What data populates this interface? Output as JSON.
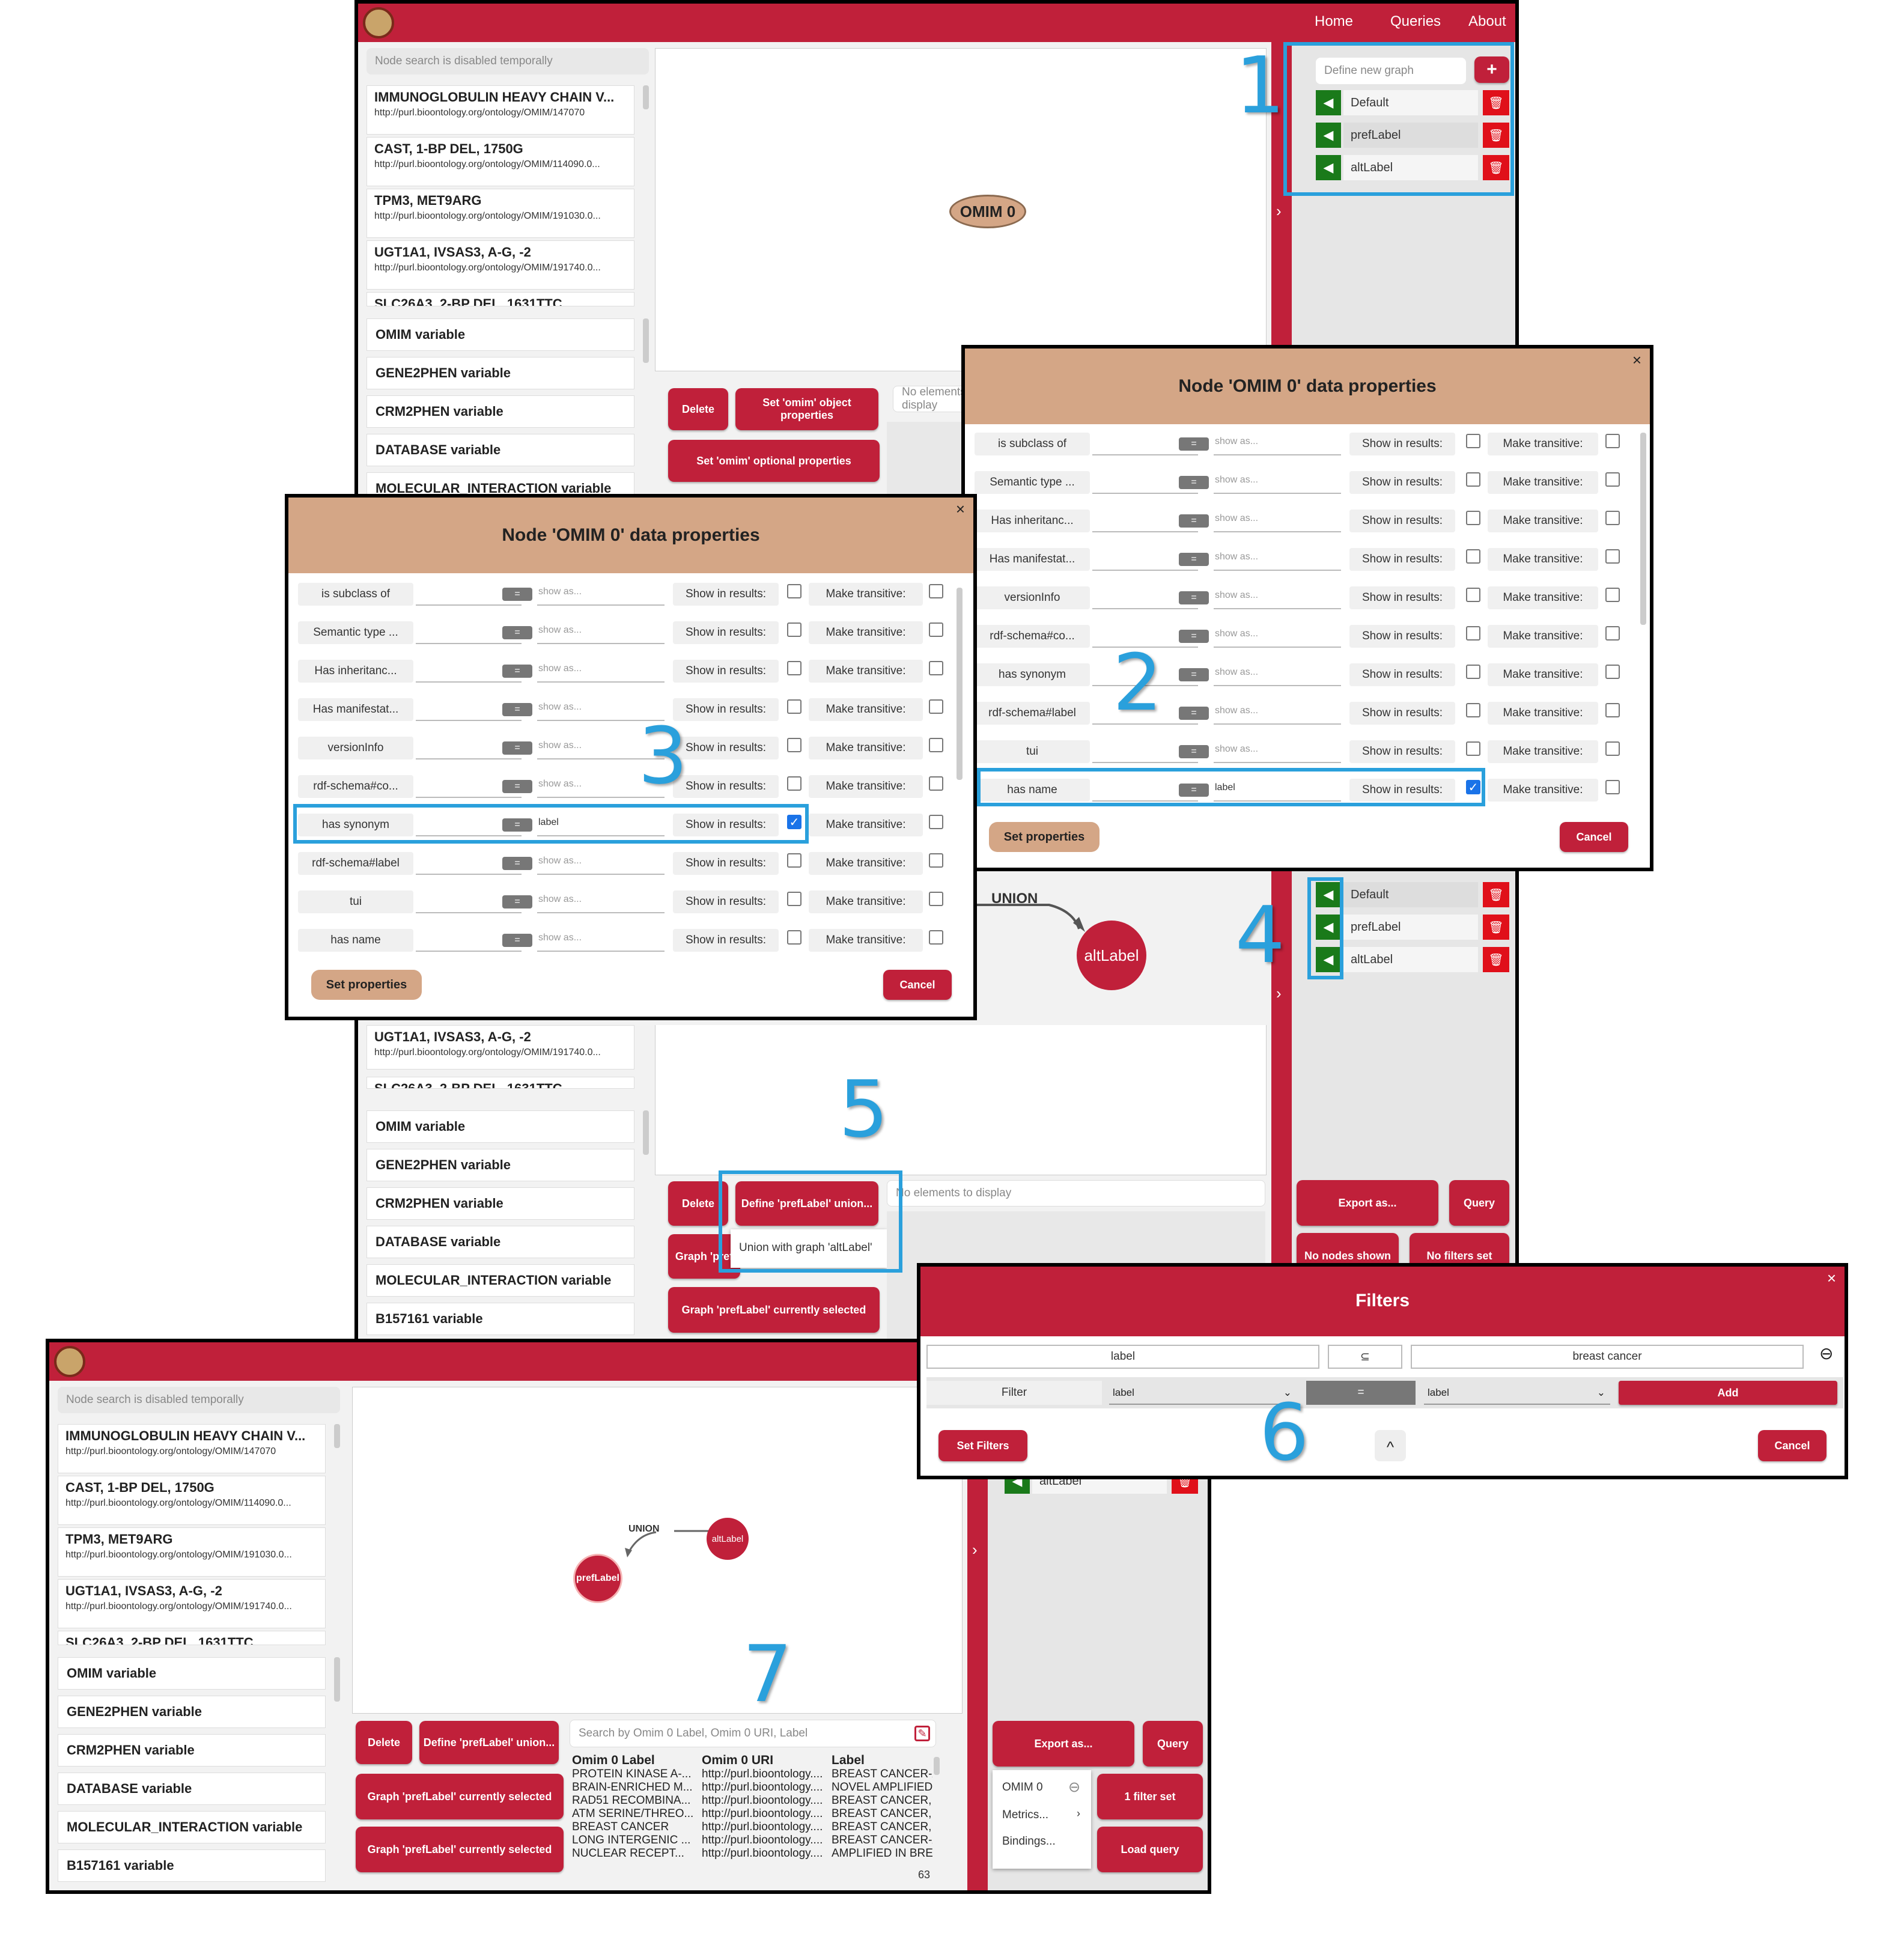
{
  "nav": {
    "home": "Home",
    "queries": "Queries",
    "about": "About"
  },
  "node_search_placeholder": "Node search is disabled temporally",
  "results": [
    {
      "title": "IMMUNOGLOBULIN HEAVY CHAIN V...",
      "url": "http://purl.bioontology.org/ontology/OMIM/147070"
    },
    {
      "title": "CAST, 1-BP DEL, 1750G",
      "url": "http://purl.bioontology.org/ontology/OMIM/114090.0..."
    },
    {
      "title": "TPM3, MET9ARG",
      "url": "http://purl.bioontology.org/ontology/OMIM/191030.0..."
    },
    {
      "title": "UGT1A1, IVSAS3, A-G, -2",
      "url": "http://purl.bioontology.org/ontology/OMIM/191740.0..."
    }
  ],
  "results_cut": "SLC26A3, 2-BP DEL, 1631TTC",
  "variables": [
    "OMIM variable",
    "GENE2PHEN variable",
    "CRM2PHEN variable",
    "DATABASE variable",
    "MOLECULAR_INTERACTION variable",
    "B157161 variable"
  ],
  "graph_panel": {
    "new_graph_placeholder": "Define new graph",
    "add_label": "+",
    "graphs": [
      "Default",
      "prefLabel",
      "altLabel"
    ],
    "toggle": "›",
    "delete_icon": "🗑",
    "select_icon": "◀"
  },
  "canvas1": {
    "node": "OMIM 0"
  },
  "canvas2": {
    "edge": "UNION",
    "node": "altLabel"
  },
  "canvas3": {
    "edge": "UNION",
    "node_a": "prefLabel",
    "node_b": "altLabel"
  },
  "buttons1": {
    "delete": "Delete",
    "set_object": "Set 'omim' object properties",
    "set_optional": "Set 'omim' optional properties",
    "no_elements": "No elements to display"
  },
  "buttons2": {
    "delete": "Delete",
    "define_union": "Define 'prefLabel' union...",
    "graph_pref_cut": "Graph 'pref",
    "union_option": "Union with graph 'altLabel'",
    "graph_selected": "Graph 'prefLabel' currently selected",
    "no_elements": "No elements to display",
    "export": "Export as...",
    "query": "Query",
    "no_nodes": "No nodes shown",
    "no_filters": "No filters set"
  },
  "modal": {
    "title": "Node 'OMIM 0' data properties",
    "close": "×",
    "show_as": "show as...",
    "eq": "=",
    "show_in_results": "Show in results:",
    "make_transitive": "Make transitive:",
    "set_properties": "Set properties",
    "cancel": "Cancel",
    "properties": [
      "is subclass of",
      "Semantic type ...",
      "Has inheritanc...",
      "Has manifestat...",
      "versionInfo",
      "rdf-schema#co...",
      "has synonym",
      "rdf-schema#label",
      "tui",
      "has name"
    ],
    "entered_value": "label",
    "check": "✓"
  },
  "filters": {
    "title": "Filters",
    "close": "×",
    "col1": "label",
    "op": "⊆",
    "col3": "breast cancer",
    "remove": "⊖",
    "filter_label": "Filter",
    "select1": "label",
    "eq": "=",
    "select2": "label",
    "add": "Add",
    "set_filters": "Set Filters",
    "cancel": "Cancel",
    "collapse": "^"
  },
  "bottom": {
    "search_placeholder": "Search by Omim 0 Label, Omim 0 URI, Label",
    "delete": "Delete",
    "define_union": "Define 'prefLabel' union...",
    "graph_selected": "Graph 'prefLabel' currently selected",
    "export": "Export as...",
    "query": "Query",
    "filter_set": "1 filter set",
    "load_query": "Load query",
    "menu": [
      "OMIM 0",
      "Metrics...",
      "Bindings..."
    ],
    "menu_remove": "⊖",
    "menu_arrow": "›",
    "sidebar_graph": "altLabel",
    "sidebar_graph_cut": "prefLabel",
    "count": "63",
    "columns": [
      "Omim 0 Label",
      "Omim 0 URI",
      "Label"
    ],
    "rows": [
      [
        "PROTEIN KINASE A-...",
        "http://purl.bioontology....",
        "BREAST CANCER-A..."
      ],
      [
        "BRAIN-ENRICHED M...",
        "http://purl.bioontology....",
        "NOVEL AMPLIFIED I..."
      ],
      [
        "RAD51 RECOMBINA...",
        "http://purl.bioontology....",
        "BREAST CANCER, F..."
      ],
      [
        "ATM SERINE/THREO...",
        "http://purl.bioontology....",
        "BREAST CANCER, F..."
      ],
      [
        "BREAST CANCER",
        "http://purl.bioontology....",
        "BREAST CANCER, F..."
      ],
      [
        "LONG INTERGENIC ...",
        "http://purl.bioontology....",
        "BREAST CANCER-A..."
      ],
      [
        "NUCLEAR RECEPT...",
        "http://purl.bioontology....",
        "AMPLIFIED IN BREA..."
      ]
    ]
  },
  "callouts": [
    "1",
    "2",
    "3",
    "4",
    "5",
    "6",
    "7"
  ],
  "colors": {
    "accent": "#c0203a",
    "tan": "#d4a686",
    "highlight": "#2aa0dc",
    "green": "#1a7a1a"
  }
}
